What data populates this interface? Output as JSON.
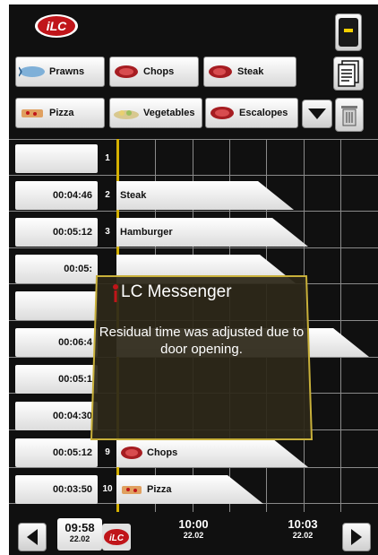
{
  "logo_text": "iLC",
  "toolbar": {
    "row1": [
      {
        "label": "Prawns",
        "icon": "prawn-icon"
      },
      {
        "label": "Chops",
        "icon": "chops-icon"
      },
      {
        "label": "Steak",
        "icon": "steak-icon"
      }
    ],
    "row2": [
      {
        "label": "Pizza",
        "icon": "pizza-icon"
      },
      {
        "label": "Vegetables",
        "icon": "vegetables-icon"
      },
      {
        "label": "Escalopes",
        "icon": "escalopes-icon"
      }
    ]
  },
  "rows": [
    {
      "num": "1",
      "time": "",
      "label": ""
    },
    {
      "num": "2",
      "time": "00:04:46",
      "label": "Steak"
    },
    {
      "num": "3",
      "time": "00:05:12",
      "label": "Hamburger"
    },
    {
      "num": "",
      "time": "00:05:",
      "label": ""
    },
    {
      "num": "",
      "time": "",
      "label": ""
    },
    {
      "num": "",
      "time": "00:06:4",
      "label": ""
    },
    {
      "num": "",
      "time": "00:05:1",
      "label": ""
    },
    {
      "num": "",
      "time": "00:04:30",
      "label": ""
    },
    {
      "num": "9",
      "time": "00:05:12",
      "label": "Chops"
    },
    {
      "num": "10",
      "time": "00:03:50",
      "label": "Pizza"
    }
  ],
  "messenger": {
    "title": "LC Messenger",
    "body": "Residual time was adjusted due to door opening."
  },
  "timeline": {
    "current": {
      "time": "09:58",
      "date": "22.02"
    },
    "marks": [
      {
        "time": "10:00",
        "date": "22.02"
      },
      {
        "time": "10:03",
        "date": "22.02"
      }
    ]
  },
  "colors": {
    "accent_red": "#c0151a",
    "background": "#101010",
    "indicator_yellow": "#f5d000",
    "gold_marker": "#d4b000"
  }
}
